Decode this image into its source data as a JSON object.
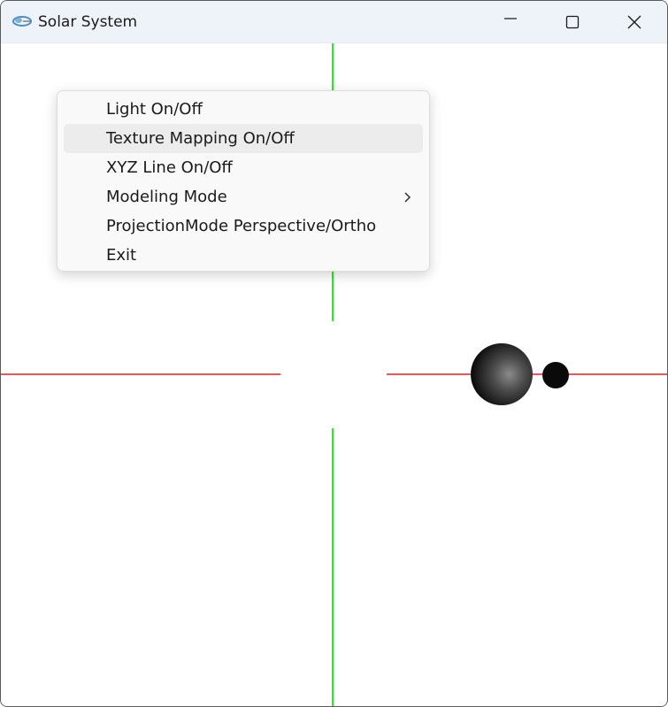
{
  "window": {
    "title": "Solar System",
    "app_icon": "opengl-app-icon",
    "controls": {
      "minimize_icon": "minimize-icon",
      "maximize_icon": "maximize-icon",
      "close_icon": "close-icon"
    }
  },
  "scene": {
    "x_axis_color": "#e02020",
    "y_axis_color": "#22ee22",
    "background": "#ffffff",
    "objects": [
      {
        "name": "planet",
        "color": "#3a3a3a"
      },
      {
        "name": "moon",
        "color": "#0a0a0a"
      }
    ]
  },
  "context_menu": {
    "items": [
      {
        "label": "Light On/Off",
        "highlighted": false,
        "has_submenu": false
      },
      {
        "label": "Texture Mapping On/Off",
        "highlighted": true,
        "has_submenu": false
      },
      {
        "label": "XYZ Line On/Off",
        "highlighted": false,
        "has_submenu": false
      },
      {
        "label": "Modeling Mode",
        "highlighted": false,
        "has_submenu": true,
        "submenu_icon": "chevron-right-icon"
      },
      {
        "label": "ProjectionMode Perspective/Ortho",
        "highlighted": false,
        "has_submenu": false
      },
      {
        "label": "Exit",
        "highlighted": false,
        "has_submenu": false
      }
    ]
  }
}
